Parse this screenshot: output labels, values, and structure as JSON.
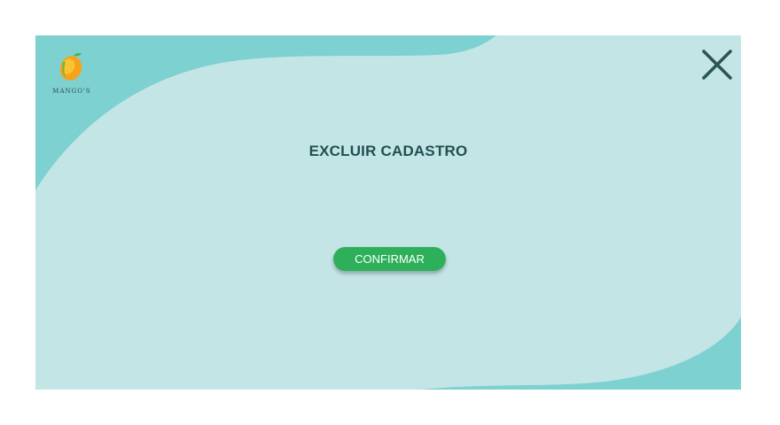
{
  "brand": {
    "name": "MANGO'S",
    "tagline": "· · · ·",
    "logo_icon": "mango-icon"
  },
  "dialog": {
    "title": "EXCLUIR CADASTRO",
    "confirm_label": "CONFIRMAR",
    "close_icon": "close-icon"
  },
  "colors": {
    "panel_background": "#c3e5e6",
    "wave_accent": "#7ed1d1",
    "title_text": "#234f52",
    "confirm_button": "#2eb05a",
    "close_icon": "#2a5552"
  }
}
